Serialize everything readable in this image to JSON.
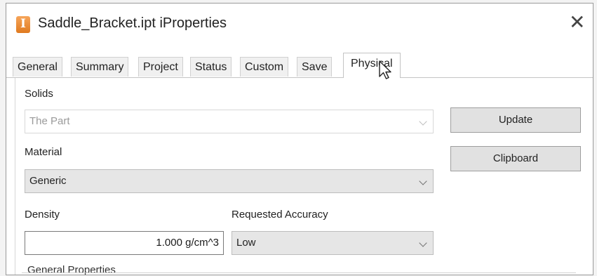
{
  "window": {
    "title": "Saddle_Bracket.ipt iProperties",
    "app_icon": "inventor-part-icon",
    "app_icon_glyph": "I",
    "close_glyph": "✕"
  },
  "tabs": [
    {
      "label": "General"
    },
    {
      "label": "Summary"
    },
    {
      "label": "Project"
    },
    {
      "label": "Status"
    },
    {
      "label": "Custom"
    },
    {
      "label": "Save"
    },
    {
      "label": "Physical",
      "active": true
    }
  ],
  "physical": {
    "solids_label": "Solids",
    "solids_value": "The Part",
    "material_label": "Material",
    "material_value": "Generic",
    "density_label": "Density",
    "density_value": "1.000 g/cm^3",
    "accuracy_label": "Requested Accuracy",
    "accuracy_value": "Low",
    "general_properties_label": "General Properties"
  },
  "buttons": {
    "update": "Update",
    "clipboard": "Clipboard"
  },
  "colors": {
    "app_icon": "#e07a1f",
    "button_face": "#e1e1e1",
    "combo_filled": "#e6e6e6"
  }
}
